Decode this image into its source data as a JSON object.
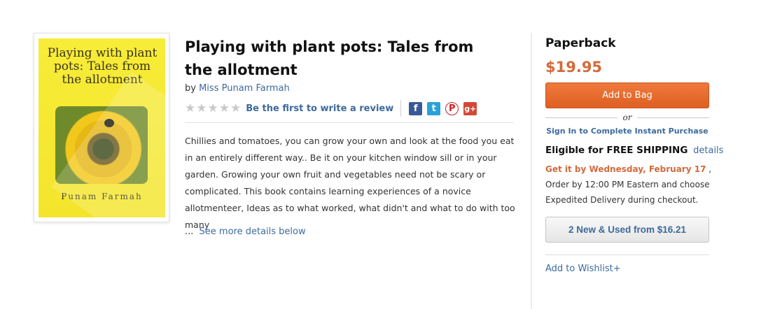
{
  "cover": {
    "title": "Playing with plant pots: Tales from the allotment",
    "author": "Punam Farmah"
  },
  "product": {
    "title": "Playing with plant pots: Tales from the allotment",
    "by_label": "by",
    "author": "Miss Punam Farmah",
    "rating_stars": 0,
    "review_link": "Be the first to write a review",
    "description": "Chillies and tomatoes, you can grow your own and look at the food you eat in an entirely different way.. Be it on your kitchen window sill or in your garden. Growing your own fruit and vegetables need not be scary or complicated. This book contains learning experiences of a novice allotmenteer, Ideas as to what worked, what didn't and what to do with too many",
    "ellipsis": "...",
    "see_more": "See more details below"
  },
  "social": {
    "facebook": "f",
    "twitter": "t",
    "pinterest": "P",
    "googleplus": "g+"
  },
  "purchase": {
    "format": "Paperback",
    "price": "$19.95",
    "add_to_bag": "Add to Bag",
    "or": "or",
    "sign_in": "Sign In to Complete Instant Purchase",
    "free_shipping": "Eligible for FREE SHIPPING",
    "details": "details",
    "get_by": "Get it by Wednesday, February 17",
    "order_text": " ,  Order by 12:00 PM Eastern and choose Expedited Delivery during checkout.",
    "new_used": "2 New & Used from $16.21",
    "wishlist": "Add to Wishlist+"
  },
  "colors": {
    "accent_orange": "#d46a3a",
    "link_blue": "#3d6a9c"
  }
}
